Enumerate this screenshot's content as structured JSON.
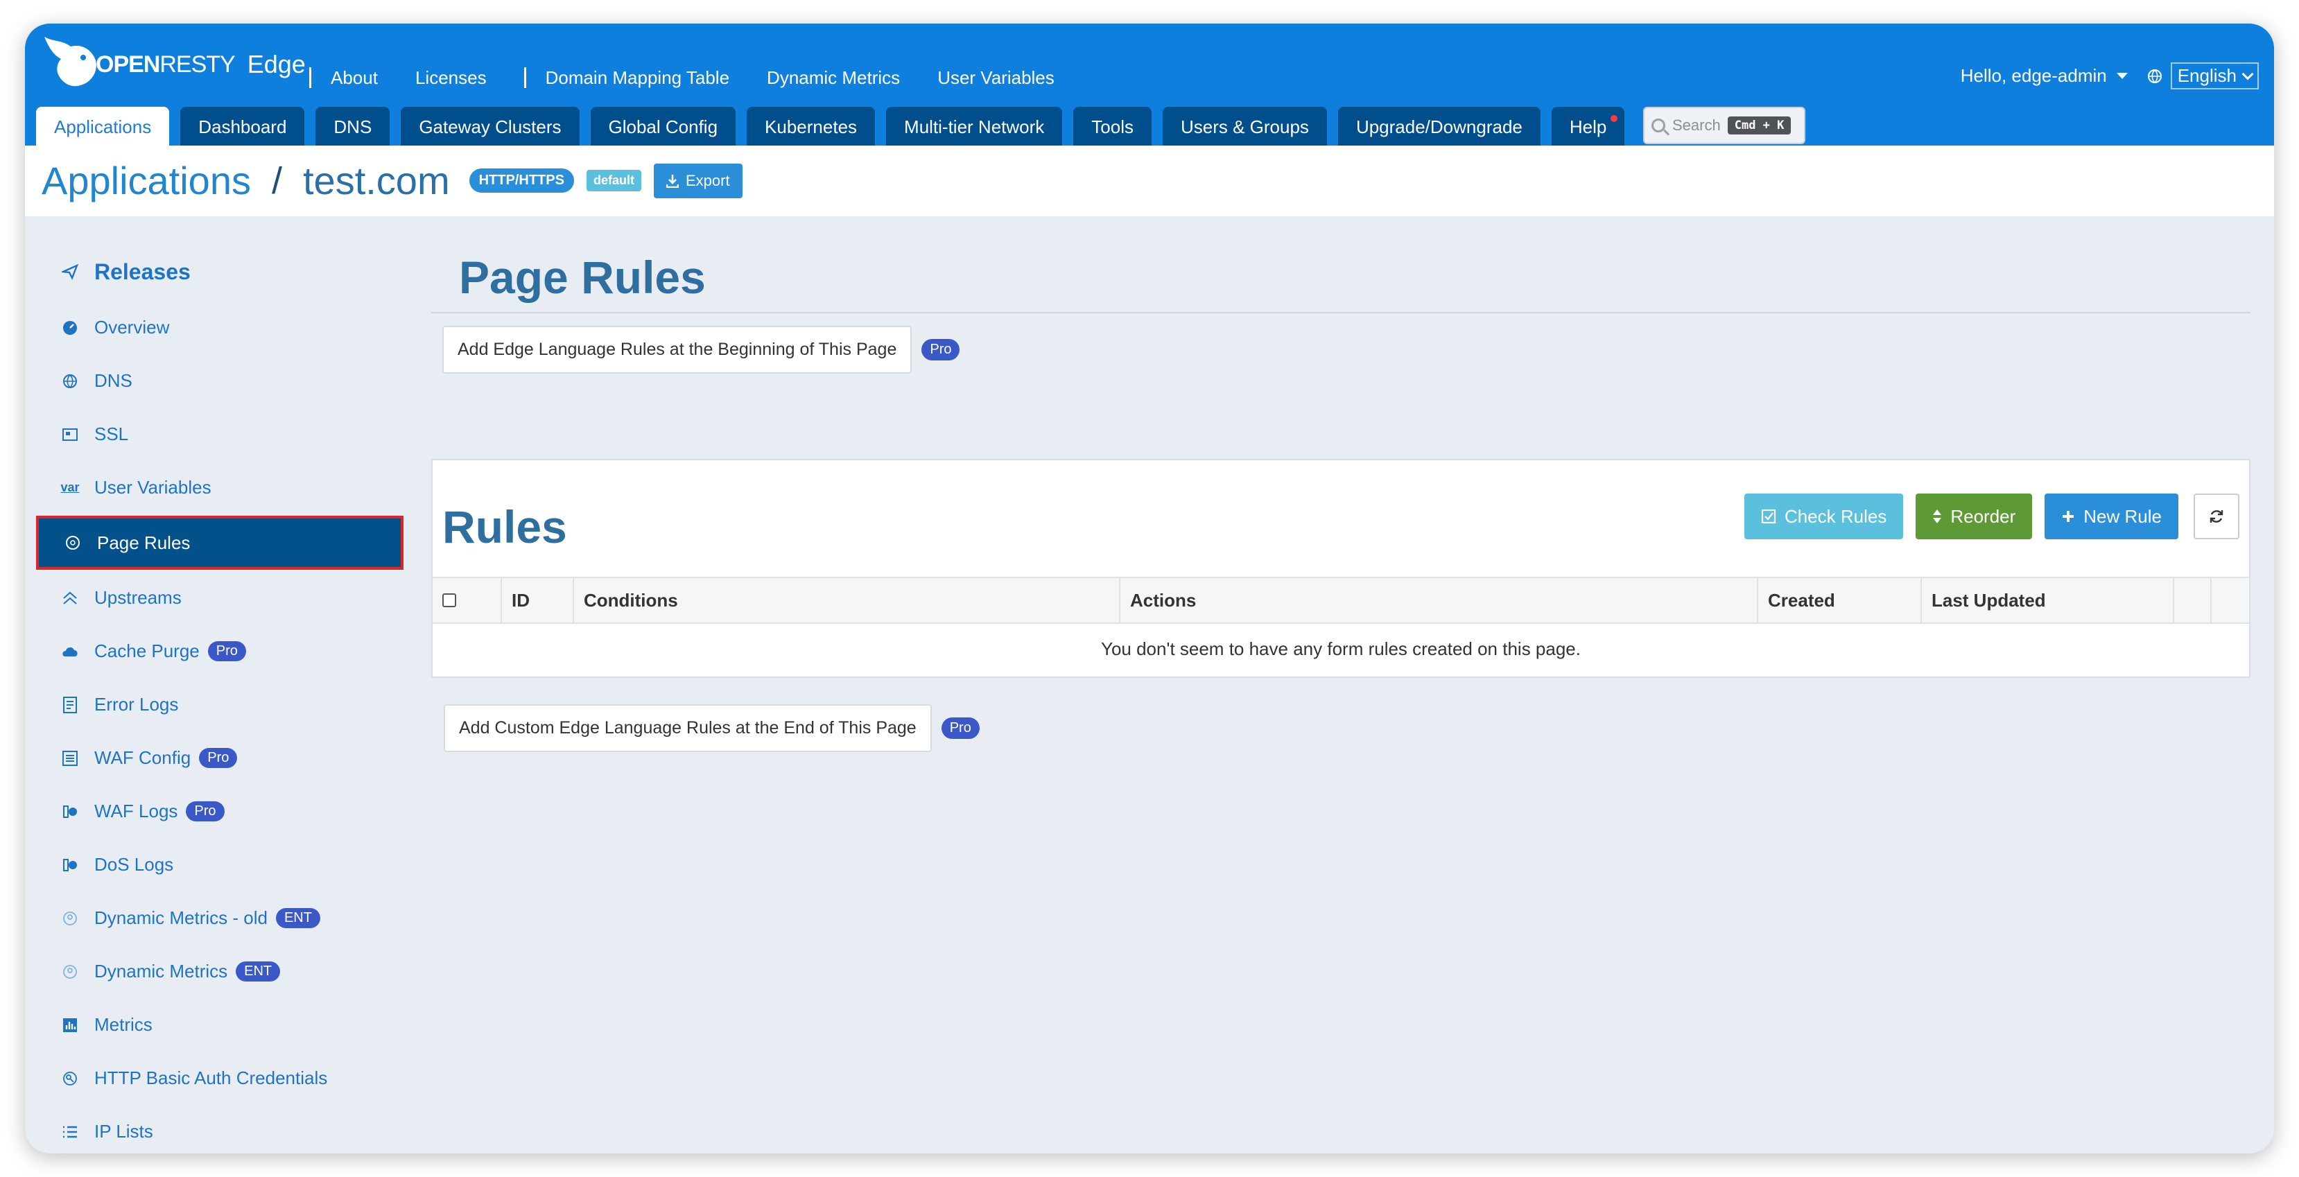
{
  "brand": {
    "logo_text_bold": "OPEN",
    "logo_text_thin": "RESTY",
    "product": "Edge"
  },
  "topnav": {
    "links": [
      "About",
      "Licenses",
      "Domain Mapping Table",
      "Dynamic Metrics",
      "User Variables"
    ],
    "user": "Hello, edge-admin",
    "language": "English"
  },
  "tabs": [
    "Applications",
    "Dashboard",
    "DNS",
    "Gateway Clusters",
    "Global Config",
    "Kubernetes",
    "Multi-tier Network",
    "Tools",
    "Users & Groups",
    "Upgrade/Downgrade",
    "Help"
  ],
  "search": {
    "placeholder": "Search",
    "shortcut": "Cmd + K"
  },
  "breadcrumb": {
    "root": "Applications",
    "separator": "/",
    "domain": "test.com",
    "protocol": "HTTP/HTTPS",
    "tag": "default",
    "export": "Export"
  },
  "sidebar": {
    "header": "Releases",
    "items": [
      {
        "label": "Overview",
        "icon": "dashboard-icon"
      },
      {
        "label": "DNS",
        "icon": "globe-icon"
      },
      {
        "label": "SSL",
        "icon": "certificate-icon"
      },
      {
        "label": "User Variables",
        "icon": "var-icon"
      },
      {
        "label": "Page Rules",
        "icon": "circle-icon",
        "active": true
      },
      {
        "label": "Upstreams",
        "icon": "chevron-up-icon"
      },
      {
        "label": "Cache Purge",
        "icon": "cloud-icon",
        "badge": "Pro"
      },
      {
        "label": "Error Logs",
        "icon": "document-icon"
      },
      {
        "label": "WAF Config",
        "icon": "list-icon",
        "badge": "Pro"
      },
      {
        "label": "WAF Logs",
        "icon": "shield-log-icon",
        "badge": "Pro"
      },
      {
        "label": "DoS Logs",
        "icon": "shield-log-icon"
      },
      {
        "label": "Dynamic Metrics - old",
        "icon": "pin-icon",
        "badge": "ENT"
      },
      {
        "label": "Dynamic Metrics",
        "icon": "pin-icon",
        "badge": "ENT"
      },
      {
        "label": "Metrics",
        "icon": "bar-chart-icon"
      },
      {
        "label": "HTTP Basic Auth Credentials",
        "icon": "key-icon"
      },
      {
        "label": "IP Lists",
        "icon": "list-icon"
      }
    ]
  },
  "main": {
    "title": "Page Rules",
    "add_begin": "Add Edge Language Rules at the Beginning of This Page",
    "add_end": "Add Custom Edge Language Rules at the End of This Page",
    "pro": "Pro",
    "rules_title": "Rules",
    "check_rules": "Check Rules",
    "reorder": "Reorder",
    "new_rule": "New Rule",
    "columns": [
      "ID",
      "Conditions",
      "Actions",
      "Created",
      "Last Updated"
    ],
    "empty_message": "You don't seem to have any form rules created on this page."
  }
}
